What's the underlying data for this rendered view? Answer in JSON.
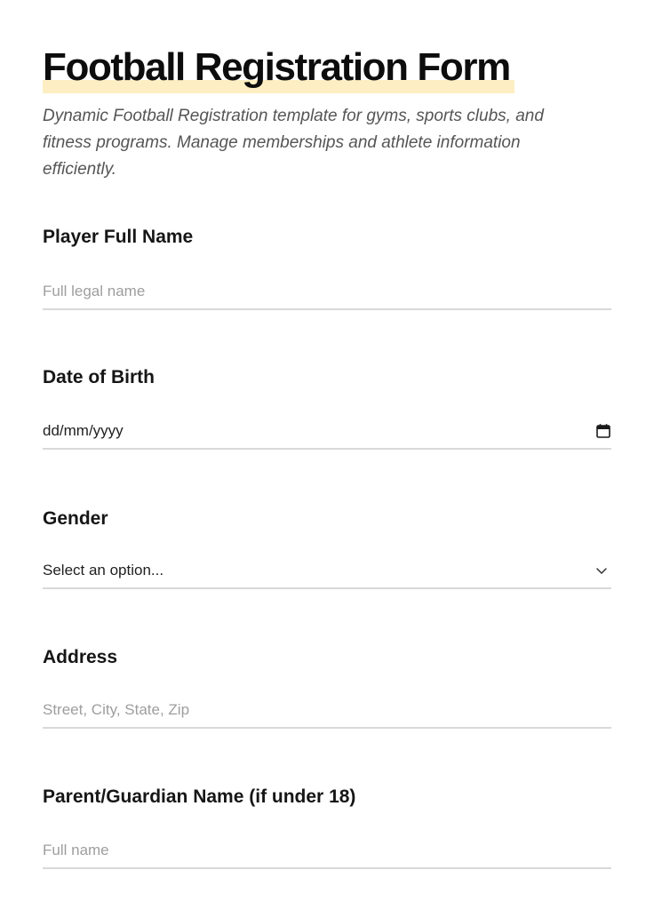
{
  "form": {
    "title": "Football Registration Form",
    "description": "Dynamic Football Registration template for gyms, sports clubs, and fitness programs. Manage memberships and athlete information efficiently."
  },
  "fields": {
    "player_name": {
      "label": "Player Full Name",
      "placeholder": "Full legal name"
    },
    "dob": {
      "label": "Date of Birth",
      "value": "dd/mm/yyyy",
      "icon": "calendar-icon"
    },
    "gender": {
      "label": "Gender",
      "selected": "Select an option...",
      "icon": "chevron-down-icon"
    },
    "address": {
      "label": "Address",
      "placeholder": "Street, City, State, Zip"
    },
    "guardian_name": {
      "label": "Parent/Guardian Name (if under 18)",
      "placeholder": "Full name"
    }
  },
  "colors": {
    "title_highlight": "#fdefc3",
    "underline": "#d9d9d9",
    "placeholder": "#9e9e9e"
  }
}
